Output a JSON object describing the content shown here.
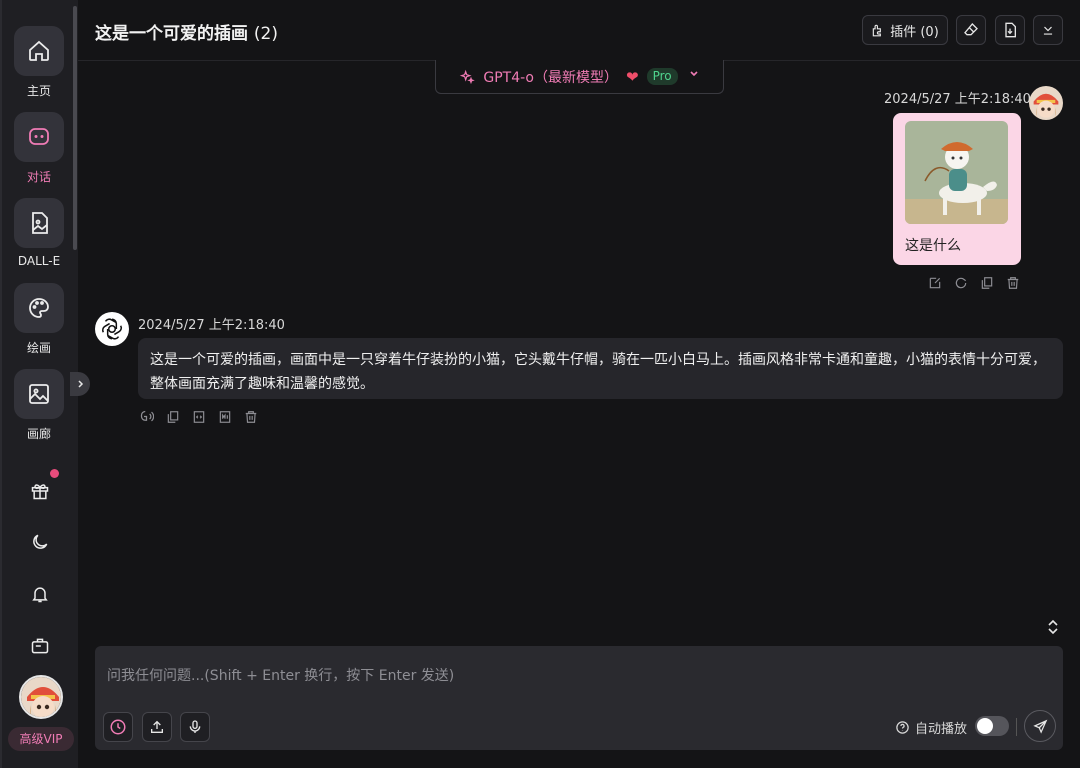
{
  "sidebar": {
    "items": [
      {
        "label": "主页"
      },
      {
        "label": "对话"
      },
      {
        "label": "DALL-E"
      },
      {
        "label": "绘画"
      },
      {
        "label": "画廊"
      }
    ],
    "vip_label": "高级VIP"
  },
  "header": {
    "title": "这是一个可爱的插画",
    "count": "(2)",
    "plugins_label": "插件 (0)"
  },
  "model": {
    "name": "GPT4-o（最新模型）",
    "badge": "Pro"
  },
  "messages": [
    {
      "role": "user",
      "time": "2024/5/27 上午2:18:40",
      "text": "这是什么"
    },
    {
      "role": "assistant",
      "time": "2024/5/27 上午2:18:40",
      "text": "这是一个可爱的插画，画面中是一只穿着牛仔装扮的小猫，它头戴牛仔帽，骑在一匹小白马上。插画风格非常卡通和童趣，小猫的表情十分可爱，整体画面充满了趣味和温馨的感觉。"
    }
  ],
  "input": {
    "placeholder": "问我任何问题...(Shift + Enter 换行，按下 Enter 发送)",
    "autoplay_label": "自动播放"
  },
  "colors": {
    "accent": "#f07cb5",
    "background": "#141416",
    "sidebar": "#1f1f23",
    "user_bubble": "#fbd6e6"
  }
}
